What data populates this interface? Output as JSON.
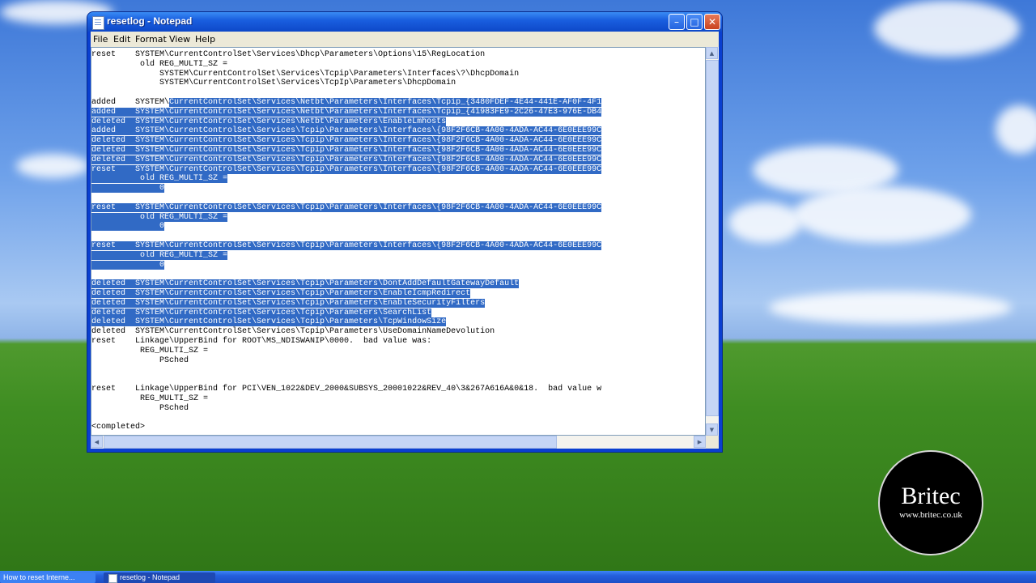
{
  "window": {
    "title": "resetlog - Notepad",
    "minimize_glyph": "–",
    "maximize_glyph": "□",
    "close_glyph": "✕"
  },
  "menu": [
    "File",
    "Edit",
    "Format",
    "View",
    "Help"
  ],
  "lines": [
    {
      "pre": "reset    SYSTEM\\CurrentControlSet\\Services\\Dhcp\\Parameters\\Options\\15\\RegLocation",
      "sel": ""
    },
    {
      "pre": "          old REG_MULTI_SZ =",
      "sel": ""
    },
    {
      "pre": "              SYSTEM\\CurrentControlSet\\Services\\Tcpip\\Parameters\\Interfaces\\?\\DhcpDomain",
      "sel": ""
    },
    {
      "pre": "              SYSTEM\\CurrentControlSet\\Services\\TcpIp\\Parameters\\DhcpDomain",
      "sel": ""
    },
    {
      "pre": "",
      "sel": ""
    },
    {
      "pre": "added    SYSTEM\\",
      "sel": "CurrentControlSet\\Services\\Netbt\\Parameters\\Interfaces\\Tcpip_{3480FDEF-4E44-441E-AF0F-4F1"
    },
    {
      "pre": "",
      "sel": "added    SYSTEM\\CurrentControlSet\\Services\\Netbt\\Parameters\\Interfaces\\Tcpip_{41983FE9-2C26-47E3-976E-DB4"
    },
    {
      "pre": "",
      "sel": "deleted  SYSTEM\\CurrentControlSet\\Services\\Netbt\\Parameters\\EnableLmhosts"
    },
    {
      "pre": "",
      "sel": "added    SYSTEM\\CurrentControlSet\\Services\\Tcpip\\Parameters\\Interfaces\\{98F2F6CB-4A00-4ADA-AC44-6E0EEE99C"
    },
    {
      "pre": "",
      "sel": "deleted  SYSTEM\\CurrentControlSet\\Services\\Tcpip\\Parameters\\Interfaces\\{98F2F6CB-4A00-4ADA-AC44-6E0EEE99C"
    },
    {
      "pre": "",
      "sel": "deleted  SYSTEM\\CurrentControlSet\\Services\\Tcpip\\Parameters\\Interfaces\\{98F2F6CB-4A00-4ADA-AC44-6E0EEE99C"
    },
    {
      "pre": "",
      "sel": "deleted  SYSTEM\\CurrentControlSet\\Services\\Tcpip\\Parameters\\Interfaces\\{98F2F6CB-4A00-4ADA-AC44-6E0EEE99C"
    },
    {
      "pre": "",
      "sel": "reset    SYSTEM\\CurrentControlSet\\Services\\Tcpip\\Parameters\\Interfaces\\{98F2F6CB-4A00-4ADA-AC44-6E0EEE99C"
    },
    {
      "pre": "",
      "sel": "          old REG_MULTI_SZ ="
    },
    {
      "pre": "",
      "sel": "              0"
    },
    {
      "pre": "",
      "sel": ""
    },
    {
      "pre": "",
      "sel": "reset    SYSTEM\\CurrentControlSet\\Services\\Tcpip\\Parameters\\Interfaces\\{98F2F6CB-4A00-4ADA-AC44-6E0EEE99C"
    },
    {
      "pre": "",
      "sel": "          old REG_MULTI_SZ ="
    },
    {
      "pre": "",
      "sel": "              0"
    },
    {
      "pre": "",
      "sel": ""
    },
    {
      "pre": "",
      "sel": "reset    SYSTEM\\CurrentControlSet\\Services\\Tcpip\\Parameters\\Interfaces\\{98F2F6CB-4A00-4ADA-AC44-6E0EEE99C"
    },
    {
      "pre": "",
      "sel": "          old REG_MULTI_SZ ="
    },
    {
      "pre": "",
      "sel": "              0"
    },
    {
      "pre": "",
      "sel": ""
    },
    {
      "pre": "",
      "sel": "deleted  SYSTEM\\CurrentControlSet\\Services\\Tcpip\\Parameters\\DontAddDefaultGatewayDefault"
    },
    {
      "pre": "",
      "sel": "deleted  SYSTEM\\CurrentControlSet\\Services\\Tcpip\\Parameters\\EnableIcmpRedirect"
    },
    {
      "pre": "",
      "sel": "deleted  SYSTEM\\CurrentControlSet\\Services\\Tcpip\\Parameters\\EnableSecurityFilters"
    },
    {
      "pre": "",
      "sel": "deleted  SYSTEM\\CurrentControlSet\\Services\\Tcpip\\Parameters\\SearchList"
    },
    {
      "pre": "",
      "sel": "deleted  SYSTEM\\CurrentControlSet\\Services\\Tcpip\\Parameters\\TcpWindowSize"
    },
    {
      "pre": "deleted  SYSTEM\\CurrentControlSet\\Services\\Tcpip\\Parameters\\UseDomainNameDevolution",
      "sel": ""
    },
    {
      "pre": "reset    Linkage\\UpperBind for ROOT\\MS_NDISWANIP\\0000.  bad value was:",
      "sel": ""
    },
    {
      "pre": "          REG_MULTI_SZ =",
      "sel": ""
    },
    {
      "pre": "              PSched",
      "sel": ""
    },
    {
      "pre": "",
      "sel": ""
    },
    {
      "pre": "",
      "sel": ""
    },
    {
      "pre": "reset    Linkage\\UpperBind for PCI\\VEN_1022&DEV_2000&SUBSYS_20001022&REV_40\\3&267A616A&0&18.  bad value w",
      "sel": ""
    },
    {
      "pre": "          REG_MULTI_SZ =",
      "sel": ""
    },
    {
      "pre": "              PSched",
      "sel": ""
    },
    {
      "pre": "",
      "sel": ""
    },
    {
      "pre": "<completed>",
      "sel": ""
    }
  ],
  "logo": {
    "name": "Britec",
    "url": "www.britec.co.uk"
  },
  "taskbar": [
    {
      "label": "How to reset Interne..."
    },
    {
      "label": "resetlog - Notepad"
    }
  ]
}
